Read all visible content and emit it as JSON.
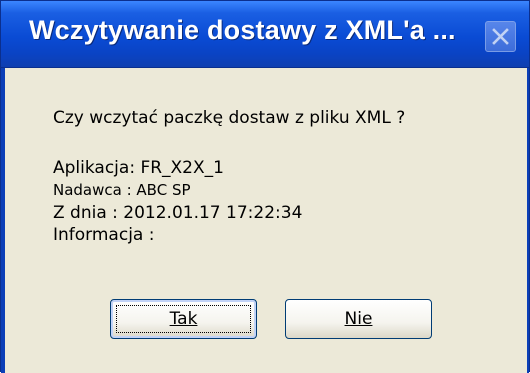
{
  "window": {
    "title": "Wczytywanie dostawy z XML'a ..."
  },
  "dialog": {
    "question": "Czy wczytać paczkę dostaw z pliku XML ?",
    "aplikacja": "Aplikacja: FR_X2X_1",
    "nadawca": "Nadawca  : ABC SP",
    "z_dnia": "Z dnia   : 2012.01.17 17:22:34",
    "informacja": "Informacja :"
  },
  "buttons": {
    "yes_label": "Tak",
    "no_label": "Nie"
  },
  "icons": {
    "close": "close-icon"
  },
  "colors": {
    "titlebar": "#0a4bd4",
    "dialog_bg": "#ece9d8",
    "title_text": "#ffffff"
  }
}
